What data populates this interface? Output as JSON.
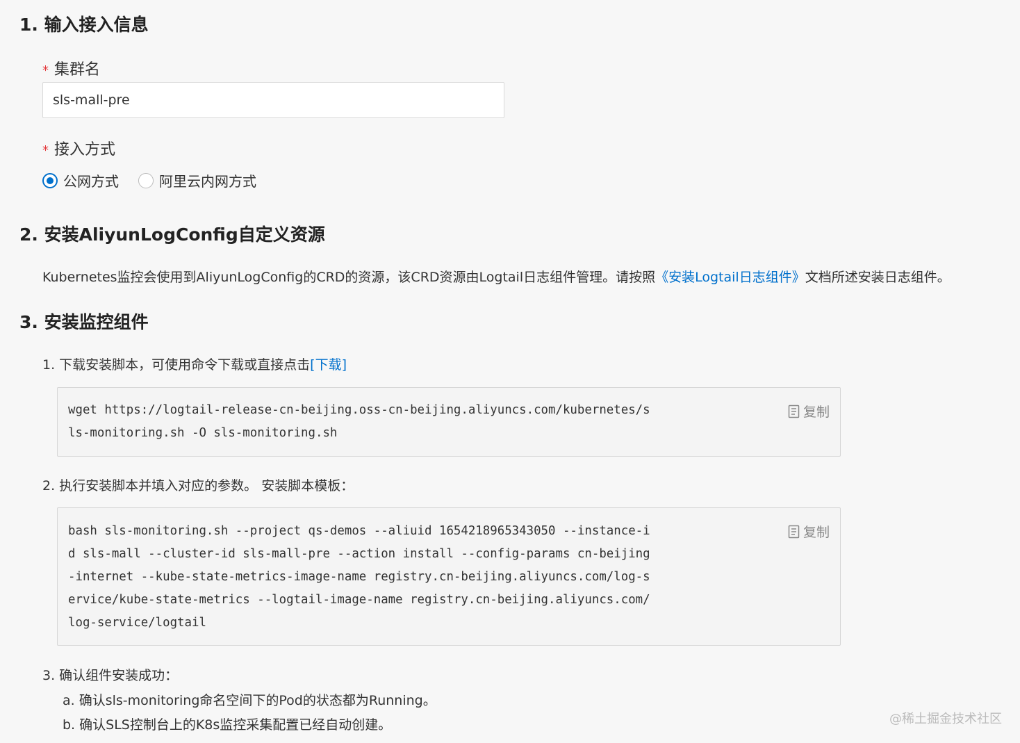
{
  "section1": {
    "title": "1. 输入接入信息",
    "cluster_label": "集群名",
    "cluster_value": "sls-mall-pre",
    "access_label": "接入方式",
    "access_options": [
      "公网方式",
      "阿里云内网方式"
    ],
    "required_mark": "*"
  },
  "section2": {
    "title": "2. 安装AliyunLogConfig自定义资源",
    "text_before": "Kubernetes监控会使用到AliyunLogConfig的CRD的资源，该CRD资源由Logtail日志组件管理。请按照",
    "link": "《安装Logtail日志组件》",
    "text_after": "文档所述安装日志组件。"
  },
  "section3": {
    "title": "3. 安装监控组件",
    "step1_text": "1. 下载安装脚本，可使用命令下载或直接点击",
    "step1_link": "[下载]",
    "code1": [
      "wget https://logtail-release-cn-beijing.oss-cn-beijing.aliyuncs.com/kubernetes/s",
      "ls-monitoring.sh -O sls-monitoring.sh"
    ],
    "copy_label": "复制",
    "step2_text": "2. 执行安装脚本并填入对应的参数。 安装脚本模板：",
    "code2": [
      "bash sls-monitoring.sh --project qs-demos --aliuid 1654218965343050 --instance-i",
      "d sls-mall --cluster-id sls-mall-pre --action install --config-params cn-beijing",
      "-internet --kube-state-metrics-image-name registry.cn-beijing.aliyuncs.com/log-s",
      "ervice/kube-state-metrics --logtail-image-name registry.cn-beijing.aliyuncs.com/",
      "log-service/logtail"
    ],
    "step3_text": "3. 确认组件安装成功：",
    "step3_items": [
      "a. 确认sls-monitoring命名空间下的Pod的状态都为Running。",
      "b. 确认SLS控制台上的K8s监控采集配置已经自动创建。"
    ]
  },
  "watermark": "@稀土掘金技术社区",
  "colors": {
    "accent": "#0070cc",
    "required": "#e4393c"
  }
}
